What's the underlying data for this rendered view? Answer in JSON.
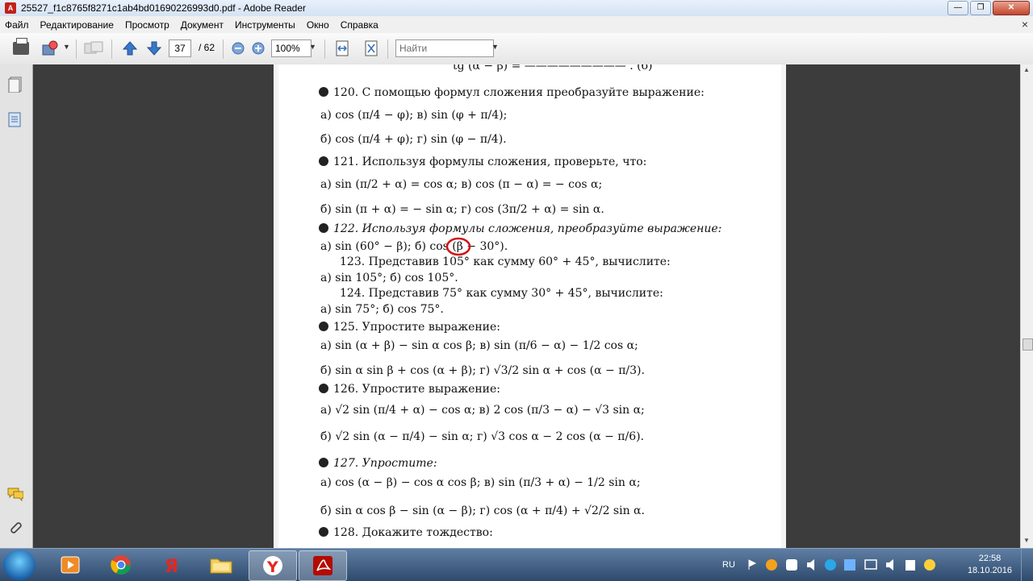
{
  "window": {
    "title": "25527_f1c8765f8271c1ab4bd01690226993d0.pdf - Adobe Reader",
    "minimize": "—",
    "maximize": "❐",
    "close": "✕"
  },
  "menu": {
    "items": [
      "Файл",
      "Редактирование",
      "Просмотр",
      "Документ",
      "Инструменты",
      "Окно",
      "Справка"
    ],
    "close": "×"
  },
  "toolbar": {
    "page_current": "37",
    "page_total": "/ 62",
    "zoom": "100%",
    "search_placeholder": "Найти"
  },
  "document": {
    "lines": [
      "tg (α − β) = ————————— .                                                   (б)",
      "120. С помощью формул сложения преобразуйте выражение:",
      "а) cos (π/4 − φ);                в) sin (φ + π/4);",
      "б) cos (π/4 + φ);                г) sin (φ − π/4).",
      "121. Используя формулы сложения, проверьте, что:",
      "а) sin (π/2 + α) = cos α;        в) cos (π − α) = − cos α;",
      "б) sin (π + α) = − sin α;        г) cos (3π/2 + α) = sin α.",
      "122. Используя формулы сложения, преобразуйте выражение:",
      "а) sin (60° − β);          б) cos (β − 30°).",
      "123. Представив 105° как сумму 60° + 45°, вычислите:",
      "а) sin 105°;        б) cos 105°.",
      "124. Представив 75° как сумму 30° + 45°, вычислите:",
      "а) sin 75°;        б) cos 75°.",
      "125. Упростите выражение:",
      "а) sin (α + β) − sin α cos β;      в) sin (π/6 − α) − 1/2 cos α;",
      "б) sin α sin β + cos (α + β);      г) √3/2 sin α + cos (α − π/3).",
      "126. Упростите выражение:",
      "а) √2 sin (π/4 + α) − cos α;       в) 2 cos (π/3 − α) − √3 sin α;",
      "б) √2 sin (α − π/4) − sin α;       г) √3 cos α − 2 cos (α − π/6).",
      "127. Упростите:",
      "а) cos (α − β) − cos α cos β;      в) sin (π/3 + α) − 1/2 sin α;",
      "б) sin α cos β − sin (α − β);      г) cos (α + π/4) + √2/2 sin α.",
      "128. Докажите тождество:"
    ]
  },
  "taskbar": {
    "language": "RU",
    "time": "22:58",
    "date": "18.10.2016"
  }
}
